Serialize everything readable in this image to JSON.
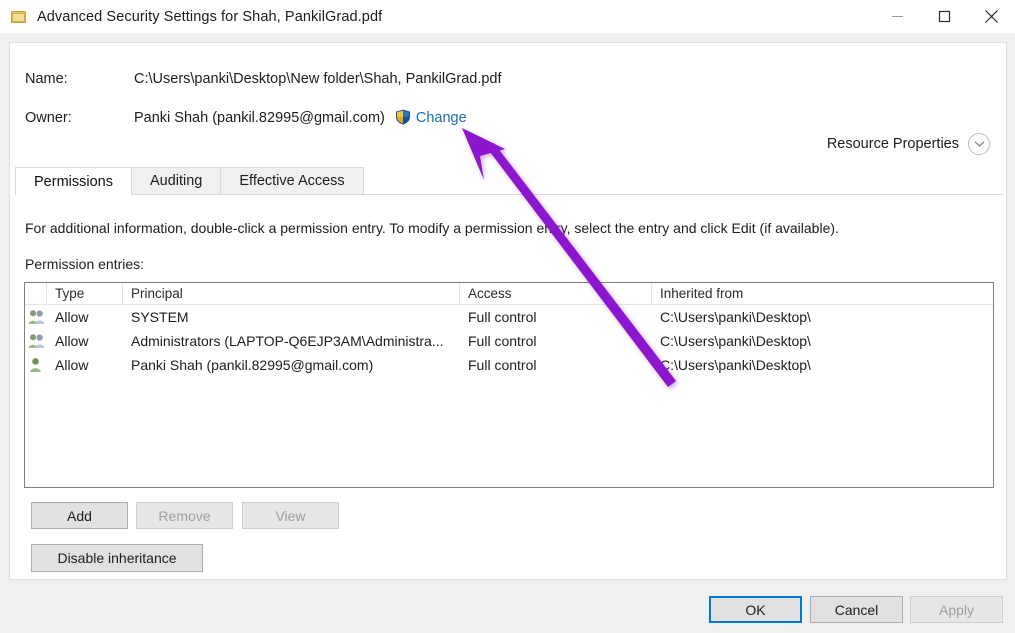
{
  "window": {
    "title": "Advanced Security Settings for Shah, PankilGrad.pdf",
    "icon": "folder-icon",
    "controls": {
      "minimize": "minimize-icon",
      "maximize": "maximize-icon",
      "close": "close-icon"
    }
  },
  "header": {
    "name_label": "Name:",
    "name_value": "C:\\Users\\panki\\Desktop\\New folder\\Shah, PankilGrad.pdf",
    "owner_label": "Owner:",
    "owner_value": "Panki Shah (pankil.82995@gmail.com)",
    "change_link": "Change",
    "change_shield_icon": "uac-shield-icon",
    "resource_properties_label": "Resource Properties",
    "resource_properties_icon": "chevron-down-icon"
  },
  "tabs": [
    {
      "label": "Permissions",
      "active": true
    },
    {
      "label": "Auditing",
      "active": false
    },
    {
      "label": "Effective Access",
      "active": false
    }
  ],
  "permissions": {
    "info_text": "For additional information, double-click a permission entry. To modify a permission entry, select the entry and click Edit (if available).",
    "entries_label": "Permission entries:",
    "columns": [
      "",
      "Type",
      "Principal",
      "Access",
      "Inherited from"
    ],
    "rows": [
      {
        "icon": "group-icon",
        "type": "Allow",
        "principal": "SYSTEM",
        "access": "Full control",
        "inherited": "C:\\Users\\panki\\Desktop\\"
      },
      {
        "icon": "group-icon",
        "type": "Allow",
        "principal": "Administrators (LAPTOP-Q6EJP3AM\\Administra...",
        "access": "Full control",
        "inherited": "C:\\Users\\panki\\Desktop\\"
      },
      {
        "icon": "user-icon",
        "type": "Allow",
        "principal": "Panki Shah (pankil.82995@gmail.com)",
        "access": "Full control",
        "inherited": "C:\\Users\\panki\\Desktop\\"
      }
    ],
    "buttons": {
      "add": "Add",
      "remove": "Remove",
      "view": "View",
      "disable_inheritance": "Disable inheritance"
    }
  },
  "footer": {
    "ok": "OK",
    "cancel": "Cancel",
    "apply": "Apply"
  },
  "annotation": {
    "type": "arrow",
    "color": "#8B14CE",
    "points_to": "change-link"
  },
  "colors": {
    "link": "#1a6cb5",
    "focus_border": "#0078d7",
    "arrow": "#8B14CE",
    "button_face": "#e1e1e1",
    "window_bg": "#f0f0f0"
  }
}
